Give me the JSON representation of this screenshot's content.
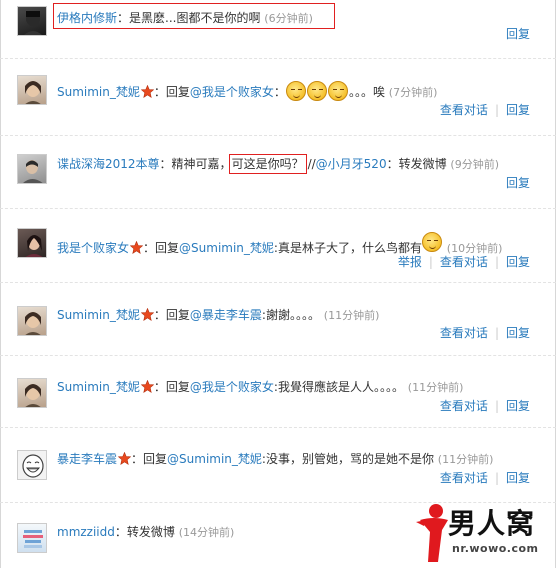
{
  "comments": [
    {
      "user": "伊格内修斯",
      "content": "：是黑麽...图都不是你的啊",
      "time": "(6分钟前)",
      "actions": {
        "reply": "回复"
      }
    },
    {
      "user": "Sumimin_梵妮",
      "content_prefix": "：回复",
      "mention": "@我是个败家女",
      "content_suffix": "：",
      "content_tail": "。。。唉",
      "time": "(7分钟前)",
      "actions": {
        "view_conversation": "查看对话",
        "reply": "回复"
      }
    },
    {
      "user": "谍战深海2012本尊",
      "content_prefix": "：精神可嘉，",
      "boxed_text": "可这是你吗？",
      "content_mid": "//",
      "mention": "@小月牙520",
      "content_suffix": "：转发微博",
      "time": "(9分钟前)",
      "actions": {
        "reply": "回复"
      }
    },
    {
      "user": "我是个败家女",
      "content_prefix": "：回复",
      "mention": "@Sumimin_梵妮",
      "content_suffix": ":真是林子大了，什么鸟都有",
      "time": "(10分钟前)",
      "actions": {
        "report": "举报",
        "view_conversation": "查看对话",
        "reply": "回复"
      }
    },
    {
      "user": "Sumimin_梵妮",
      "content_prefix": "：回复",
      "mention": "@暴走李车震",
      "content_suffix": ":謝謝。。。。",
      "time": "(11分钟前)",
      "actions": {
        "view_conversation": "查看对话",
        "reply": "回复"
      }
    },
    {
      "user": "Sumimin_梵妮",
      "content_prefix": "：回复",
      "mention": "@我是个败家女",
      "content_suffix": ":我覺得應該是人人。。。。",
      "time": "(11分钟前)",
      "actions": {
        "view_conversation": "查看对话",
        "reply": "回复"
      }
    },
    {
      "user": "暴走李车震",
      "content_prefix": "：回复",
      "mention": "@Sumimin_梵妮",
      "content_suffix": ":没事，别管她，骂的是她不是你",
      "time": "(11分钟前)",
      "actions": {
        "view_conversation": "查看对话",
        "reply": "回复"
      }
    },
    {
      "user": "mmzziidd",
      "content": "：转发微博",
      "time": "(14分钟前)"
    }
  ],
  "watermark": {
    "brand": "男人窝",
    "url": "nr.wowo.com"
  },
  "colors": {
    "link": "#2a7bbd",
    "time": "#999999",
    "highlight_box": "#e02020"
  }
}
